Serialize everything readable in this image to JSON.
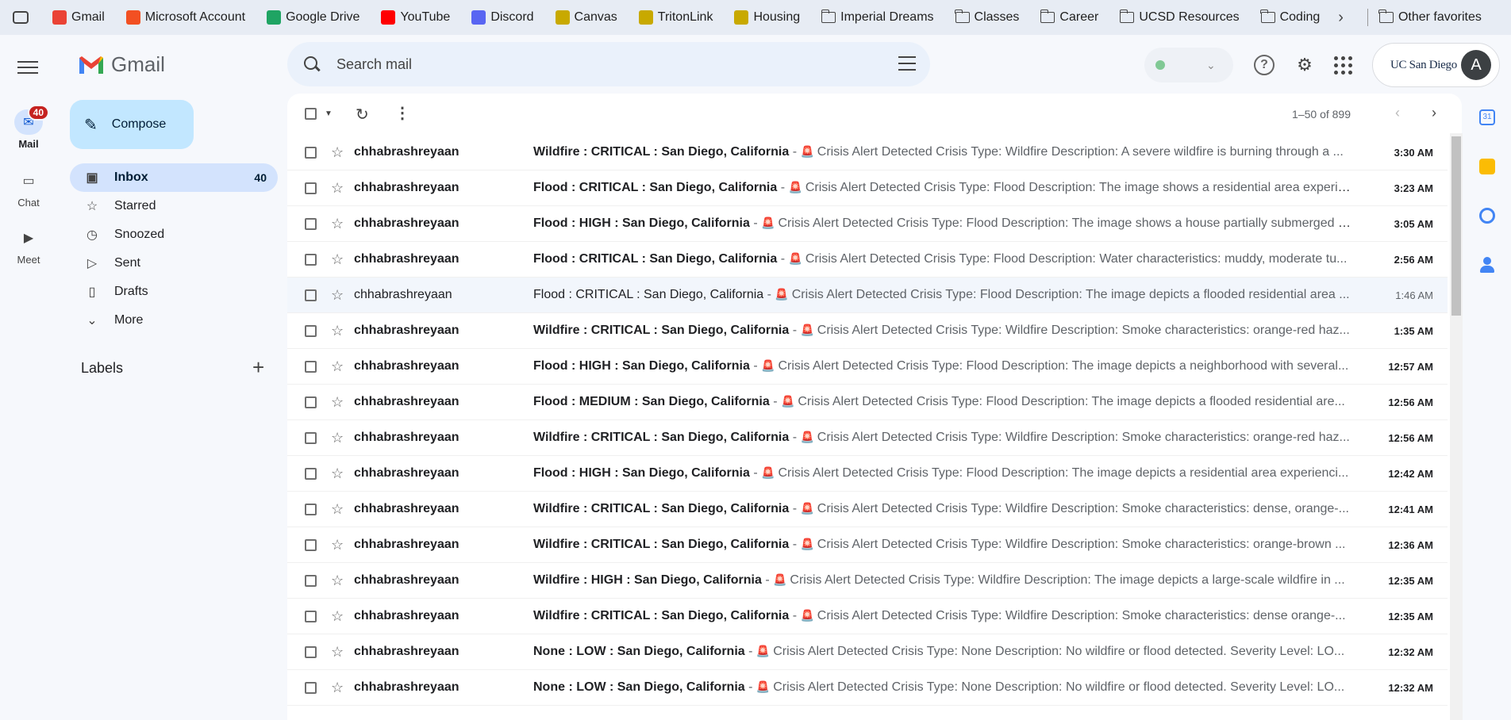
{
  "bookmarks": [
    {
      "label": "Gmail",
      "icon": "gmail-icon",
      "color": "#ea4335"
    },
    {
      "label": "Microsoft Account",
      "icon": "microsoft-icon",
      "color": "#f25022"
    },
    {
      "label": "Google Drive",
      "icon": "google-drive-icon",
      "color": "#1fa463"
    },
    {
      "label": "YouTube",
      "icon": "youtube-icon",
      "color": "#ff0000"
    },
    {
      "label": "Discord",
      "icon": "discord-icon",
      "color": "#5865f2"
    },
    {
      "label": "Canvas",
      "icon": "canvas-icon",
      "color": "#c8a900"
    },
    {
      "label": "TritonLink",
      "icon": "tritonlink-icon",
      "color": "#c8a900"
    },
    {
      "label": "Housing",
      "icon": "housing-icon",
      "color": "#c8a900"
    },
    {
      "label": "Imperial Dreams",
      "icon": "folder-icon"
    },
    {
      "label": "Classes",
      "icon": "folder-icon"
    },
    {
      "label": "Career",
      "icon": "folder-icon"
    },
    {
      "label": "UCSD Resources",
      "icon": "folder-icon"
    },
    {
      "label": "Coding",
      "icon": "folder-icon"
    }
  ],
  "bookmarks_other": "Other favorites",
  "rail": {
    "mail": "Mail",
    "mail_badge": "40",
    "chat": "Chat",
    "meet": "Meet"
  },
  "app_name": "Gmail",
  "compose_label": "Compose",
  "nav": [
    {
      "label": "Inbox",
      "count": "40",
      "icon": "inbox-icon",
      "active": true
    },
    {
      "label": "Starred",
      "count": "",
      "icon": "star-icon"
    },
    {
      "label": "Snoozed",
      "count": "",
      "icon": "clock-icon"
    },
    {
      "label": "Sent",
      "count": "",
      "icon": "send-icon"
    },
    {
      "label": "Drafts",
      "count": "",
      "icon": "draft-icon"
    },
    {
      "label": "More",
      "count": "",
      "icon": "chevron-down-icon"
    }
  ],
  "labels_heading": "Labels",
  "search": {
    "placeholder": "Search mail"
  },
  "account": {
    "org": "UC San Diego",
    "avatar_letter": "A"
  },
  "pager": "1–50 of 899",
  "emails": [
    {
      "sender": "chhabrashreyaan",
      "subject": "Wildfire : CRITICAL : San Diego, California",
      "snippet": "Crisis Alert Detected Crisis Type: Wildfire Description: A severe wildfire is burning through a ...",
      "time": "3:30 AM",
      "read": false
    },
    {
      "sender": "chhabrashreyaan",
      "subject": "Flood : CRITICAL : San Diego, California",
      "snippet": "Crisis Alert Detected Crisis Type: Flood Description: The image shows a residential area experie...",
      "time": "3:23 AM",
      "read": false
    },
    {
      "sender": "chhabrashreyaan",
      "subject": "Flood : HIGH : San Diego, California",
      "snippet": "Crisis Alert Detected Crisis Type: Flood Description: The image shows a house partially submerged i...",
      "time": "3:05 AM",
      "read": false
    },
    {
      "sender": "chhabrashreyaan",
      "subject": "Flood : CRITICAL : San Diego, California",
      "snippet": "Crisis Alert Detected Crisis Type: Flood Description: Water characteristics: muddy, moderate tu...",
      "time": "2:56 AM",
      "read": false
    },
    {
      "sender": "chhabrashreyaan",
      "subject": "Flood : CRITICAL : San Diego, California",
      "snippet": "Crisis Alert Detected Crisis Type: Flood Description: The image depicts a flooded residential area ...",
      "time": "1:46 AM",
      "read": true
    },
    {
      "sender": "chhabrashreyaan",
      "subject": "Wildfire : CRITICAL : San Diego, California",
      "snippet": "Crisis Alert Detected Crisis Type: Wildfire Description: Smoke characteristics: orange-red haz...",
      "time": "1:35 AM",
      "read": false
    },
    {
      "sender": "chhabrashreyaan",
      "subject": "Flood : HIGH : San Diego, California",
      "snippet": "Crisis Alert Detected Crisis Type: Flood Description: The image depicts a neighborhood with several...",
      "time": "12:57 AM",
      "read": false
    },
    {
      "sender": "chhabrashreyaan",
      "subject": "Flood : MEDIUM : San Diego, California",
      "snippet": "Crisis Alert Detected Crisis Type: Flood Description: The image depicts a flooded residential are...",
      "time": "12:56 AM",
      "read": false
    },
    {
      "sender": "chhabrashreyaan",
      "subject": "Wildfire : CRITICAL : San Diego, California",
      "snippet": "Crisis Alert Detected Crisis Type: Wildfire Description: Smoke characteristics: orange-red haz...",
      "time": "12:56 AM",
      "read": false
    },
    {
      "sender": "chhabrashreyaan",
      "subject": "Flood : HIGH : San Diego, California",
      "snippet": "Crisis Alert Detected Crisis Type: Flood Description: The image depicts a residential area experienci...",
      "time": "12:42 AM",
      "read": false
    },
    {
      "sender": "chhabrashreyaan",
      "subject": "Wildfire : CRITICAL : San Diego, California",
      "snippet": "Crisis Alert Detected Crisis Type: Wildfire Description: Smoke characteristics: dense, orange-...",
      "time": "12:41 AM",
      "read": false
    },
    {
      "sender": "chhabrashreyaan",
      "subject": "Wildfire : CRITICAL : San Diego, California",
      "snippet": "Crisis Alert Detected Crisis Type: Wildfire Description: Smoke characteristics: orange-brown ...",
      "time": "12:36 AM",
      "read": false
    },
    {
      "sender": "chhabrashreyaan",
      "subject": "Wildfire : HIGH : San Diego, California",
      "snippet": "Crisis Alert Detected Crisis Type: Wildfire Description: The image depicts a large-scale wildfire in ...",
      "time": "12:35 AM",
      "read": false
    },
    {
      "sender": "chhabrashreyaan",
      "subject": "Wildfire : CRITICAL : San Diego, California",
      "snippet": "Crisis Alert Detected Crisis Type: Wildfire Description: Smoke characteristics: dense orange-...",
      "time": "12:35 AM",
      "read": false
    },
    {
      "sender": "chhabrashreyaan",
      "subject": "None : LOW : San Diego, California",
      "snippet": "Crisis Alert Detected Crisis Type: None Description: No wildfire or flood detected. Severity Level: LO...",
      "time": "12:32 AM",
      "read": false
    },
    {
      "sender": "chhabrashreyaan",
      "subject": "None : LOW : San Diego, California",
      "snippet": "Crisis Alert Detected Crisis Type: None Description: No wildfire or flood detected. Severity Level: LO...",
      "time": "12:32 AM",
      "read": false
    }
  ]
}
